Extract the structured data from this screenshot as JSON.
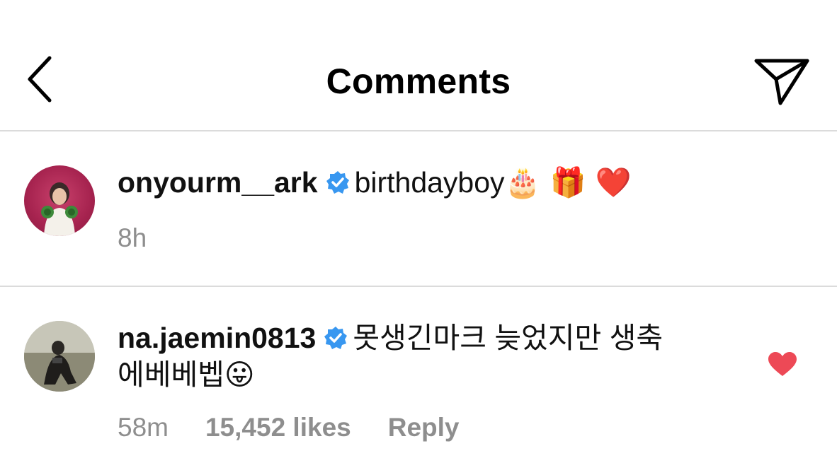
{
  "header": {
    "title": "Comments"
  },
  "comments": [
    {
      "username": "onyourm__ark",
      "text": "birthdayboy",
      "emojis": "🎂 🎁 ❤️",
      "time": "8h"
    },
    {
      "username": "na.jaemin0813",
      "text_line1": "못생긴마크 늦었지만 생축",
      "text_line2": "에베베벱",
      "emojis": "😛",
      "time": "58m",
      "likes": "15,452 likes",
      "reply": "Reply",
      "liked": true
    }
  ],
  "colors": {
    "verified": "#3897f0",
    "like": "#ed4956",
    "muted": "#8e8e8e",
    "divider": "#dbdbdb"
  },
  "icons": {
    "back": "chevron-left-icon",
    "send": "paper-plane-icon",
    "verified": "verified-badge-icon",
    "like": "heart-filled-icon"
  }
}
